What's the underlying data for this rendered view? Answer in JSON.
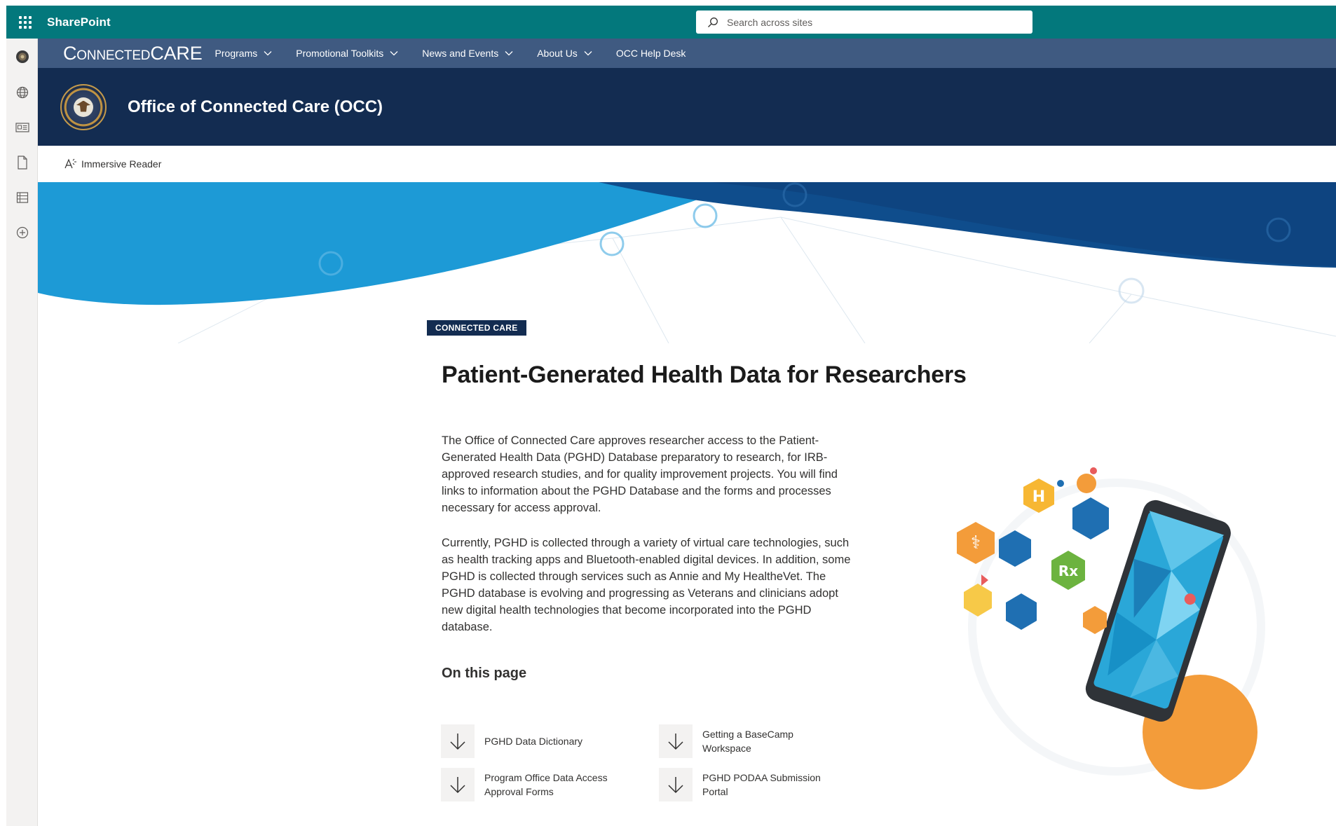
{
  "suitebar": {
    "app_name": "SharePoint",
    "search_placeholder": "Search across sites",
    "background_color": "#03787c"
  },
  "appbar": {
    "items": [
      {
        "icon": "va-seal-icon"
      },
      {
        "icon": "globe-icon"
      },
      {
        "icon": "news-icon"
      },
      {
        "icon": "document-icon"
      },
      {
        "icon": "list-icon"
      },
      {
        "icon": "add-circle-icon"
      }
    ]
  },
  "hubnav": {
    "brand": {
      "part1": "Connected",
      "part2": "CARE"
    },
    "items": [
      {
        "label": "Programs",
        "has_dropdown": true
      },
      {
        "label": "Promotional Toolkits",
        "has_dropdown": true
      },
      {
        "label": "News and Events",
        "has_dropdown": true
      },
      {
        "label": "About Us",
        "has_dropdown": true
      },
      {
        "label": "OCC Help Desk",
        "has_dropdown": false
      }
    ],
    "background_color": "#3f5a81"
  },
  "site_header": {
    "title": "Office of Connected Care (OCC)",
    "logo_icon": "va-seal-icon",
    "background_color": "#132c51"
  },
  "commandbar": {
    "immersive_reader_label": "Immersive Reader"
  },
  "content": {
    "tag": "CONNECTED CARE",
    "title": "Patient-Generated Health Data for Researchers",
    "paragraph1": "The Office of Connected Care approves researcher access to the Patient-Generated Health Data (PGHD) Database preparatory to research, for IRB-approved research studies, and for quality improvement projects. You will find links to information about the PGHD Database and the forms and processes necessary for access approval.",
    "paragraph2": "Currently, PGHD is collected through a variety of virtual care technologies, such as health tracking apps and Bluetooth-enabled digital devices. In addition, some PGHD is collected through services such as Annie and My HealtheVet. The PGHD database is evolving and progressing as Veterans and clinicians adopt new digital health technologies that become incorporated into the PGHD database.",
    "on_this_page_heading": "On this page",
    "quick_links": [
      {
        "label": "PGHD Data Dictionary",
        "icon": "arrow-down-icon"
      },
      {
        "label": "Getting a BaseCamp Workspace",
        "icon": "arrow-down-icon"
      },
      {
        "label": "Program Office Data Access Approval Forms",
        "icon": "arrow-down-icon"
      },
      {
        "label": "PGHD PODAA Submission Portal",
        "icon": "arrow-down-icon"
      }
    ]
  },
  "illustration": {
    "hex_labels": [
      "H",
      "Rx"
    ]
  },
  "colors": {
    "hero_light_blue": "#1d9ad6",
    "hero_dark_blue": "#0f4d8c",
    "accent_orange": "#f39c3a",
    "accent_green": "#6cb33f"
  }
}
